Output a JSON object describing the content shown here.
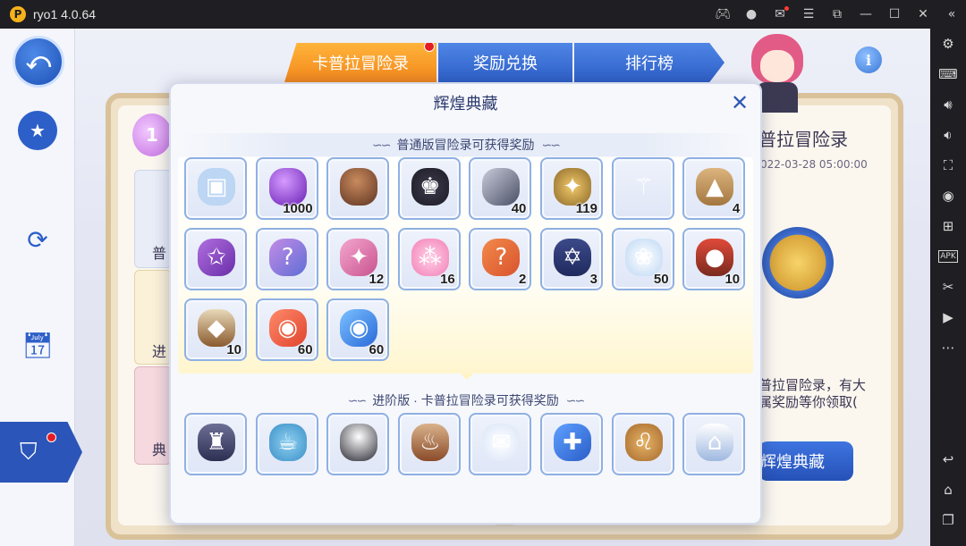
{
  "window": {
    "app_title": "ryo1 4.0.64",
    "toolbar_icons": [
      "gamepad-icon",
      "account-icon",
      "mail-icon",
      "menu-icon",
      "popout-icon",
      "minimize-icon",
      "maximize-icon",
      "close-icon",
      "collapse-icon"
    ]
  },
  "emulator_sidebar": {
    "icons": [
      "settings-icon",
      "keyboard-icon",
      "volume-up-icon",
      "volume-down-icon",
      "screenshot-icon",
      "record-icon",
      "multi-instance-icon",
      "apk-icon",
      "scissors-icon",
      "video-icon",
      "more-icon"
    ],
    "apk_label": "APK",
    "nav_icons": [
      "back-arrow-icon",
      "home-icon",
      "recents-icon"
    ]
  },
  "game": {
    "left_rail": {
      "back_glyph": "⤺",
      "items": [
        "back-button",
        "favorites-button",
        "character-button",
        "calendar-button",
        "adventure-log-button"
      ]
    },
    "tabs": [
      {
        "label": "卡普拉冒险录",
        "active": true,
        "badge": true
      },
      {
        "label": "奖励兑换",
        "active": false
      },
      {
        "label": "排行榜",
        "active": false
      }
    ],
    "info_label": "i",
    "background": {
      "medal_text": "1",
      "left_labels": [
        "普",
        "进",
        "典"
      ],
      "right_title": "普拉冒险录",
      "right_date": "022-03-28 05:00:00",
      "right_desc_line1": "普拉冒险录，有大",
      "right_desc_line2": "属奖励等你领取(",
      "right_button": "辉煌典藏"
    }
  },
  "modal": {
    "title": "辉煌典藏",
    "section_normal": "普通版冒险录可获得奖励",
    "section_advanced": "进阶版 · 卡普拉冒险录可获得奖励",
    "swirl": "∽∽",
    "normal_rewards": [
      {
        "name": "ticket-card-item",
        "qty": ""
      },
      {
        "name": "purple-coin-item",
        "qty": "1000"
      },
      {
        "name": "egg-item",
        "qty": ""
      },
      {
        "name": "cat-hat-item",
        "qty": ""
      },
      {
        "name": "ore-item",
        "qty": "40"
      },
      {
        "name": "angel-coin-item",
        "qty": "119"
      },
      {
        "name": "staff-item",
        "qty": ""
      },
      {
        "name": "treasure-box-item",
        "qty": "4"
      },
      {
        "name": "star-gem-item",
        "qty": ""
      },
      {
        "name": "mystery-gem-item",
        "qty": ""
      },
      {
        "name": "pink-crystal-item",
        "qty": "12"
      },
      {
        "name": "pink-dust-item",
        "qty": "16"
      },
      {
        "name": "puzzle-piece-item",
        "qty": "2"
      },
      {
        "name": "star-chest-item",
        "qty": "3"
      },
      {
        "name": "lotus-item",
        "qty": "50"
      },
      {
        "name": "bento-item",
        "qty": "10"
      },
      {
        "name": "food-box-item",
        "qty": "10"
      },
      {
        "name": "red-ticket-item",
        "qty": "60"
      },
      {
        "name": "blue-ticket-item",
        "qty": "60"
      }
    ],
    "advanced_rewards": [
      {
        "name": "wizard-costume-item",
        "qty": ""
      },
      {
        "name": "teapot-item",
        "qty": ""
      },
      {
        "name": "egg-hat-item",
        "qty": ""
      },
      {
        "name": "fireplace-item",
        "qty": ""
      },
      {
        "name": "wings-letter-item",
        "qty": ""
      },
      {
        "name": "blue-gift-item",
        "qty": ""
      },
      {
        "name": "lion-costume-item",
        "qty": ""
      },
      {
        "name": "bird-house-item",
        "qty": ""
      }
    ]
  },
  "colors": {
    "tab_active": "#f2871c",
    "tab_inactive": "#2d5ec6",
    "slot_border": "#8fb0e3",
    "badge": "#e51c23",
    "title": "#2b3a6e"
  }
}
